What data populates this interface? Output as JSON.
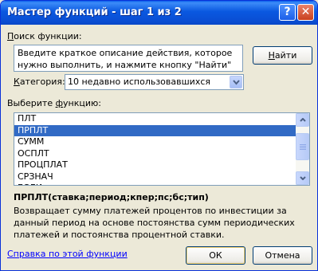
{
  "window": {
    "title": "Мастер функций - шаг 1 из 2",
    "help_glyph": "?",
    "close_glyph": "✕"
  },
  "search": {
    "label_pre": "",
    "label_acc": "П",
    "label_post": "оиск функции:",
    "description": "Введите краткое описание действия, которое нужно выполнить, и нажмите кнопку \"Найти\"",
    "find_button_acc": "Н",
    "find_button_post": "айти"
  },
  "category": {
    "label_pre": "",
    "label_acc": "К",
    "label_post": "атегория:",
    "selected": "10 недавно использовавшихся"
  },
  "functions": {
    "label_pre": "Выберите ",
    "label_acc": "ф",
    "label_post": "ункцию:",
    "items": [
      "ПЛТ",
      "ПРПЛТ",
      "СУММ",
      "ОСПЛТ",
      "ПРОЦПЛАТ",
      "СРЗНАЧ",
      "ЕСЛИ"
    ],
    "selected_index": 1
  },
  "selected_function": {
    "signature": "ПРПЛТ(ставка;период;кпер;пс;бс;тип)",
    "description": "Возвращает сумму платежей процентов по инвестиции за данный период на основе постоянства сумм периодических платежей и постоянства процентной ставки."
  },
  "footer": {
    "help_link": "Справка по этой функции",
    "ok_label": "ОК",
    "cancel_label": "Отмена"
  },
  "colors": {
    "titlebar": "#0A58E0",
    "selection": "#316AC5",
    "link": "#0000FF",
    "dialog_bg": "#ECE9D8"
  },
  "icons": {
    "help": "question-mark-icon",
    "close": "close-x-icon",
    "dropdown": "chevron-down-icon",
    "scroll_up": "arrow-up-icon",
    "scroll_down": "arrow-down-icon"
  }
}
